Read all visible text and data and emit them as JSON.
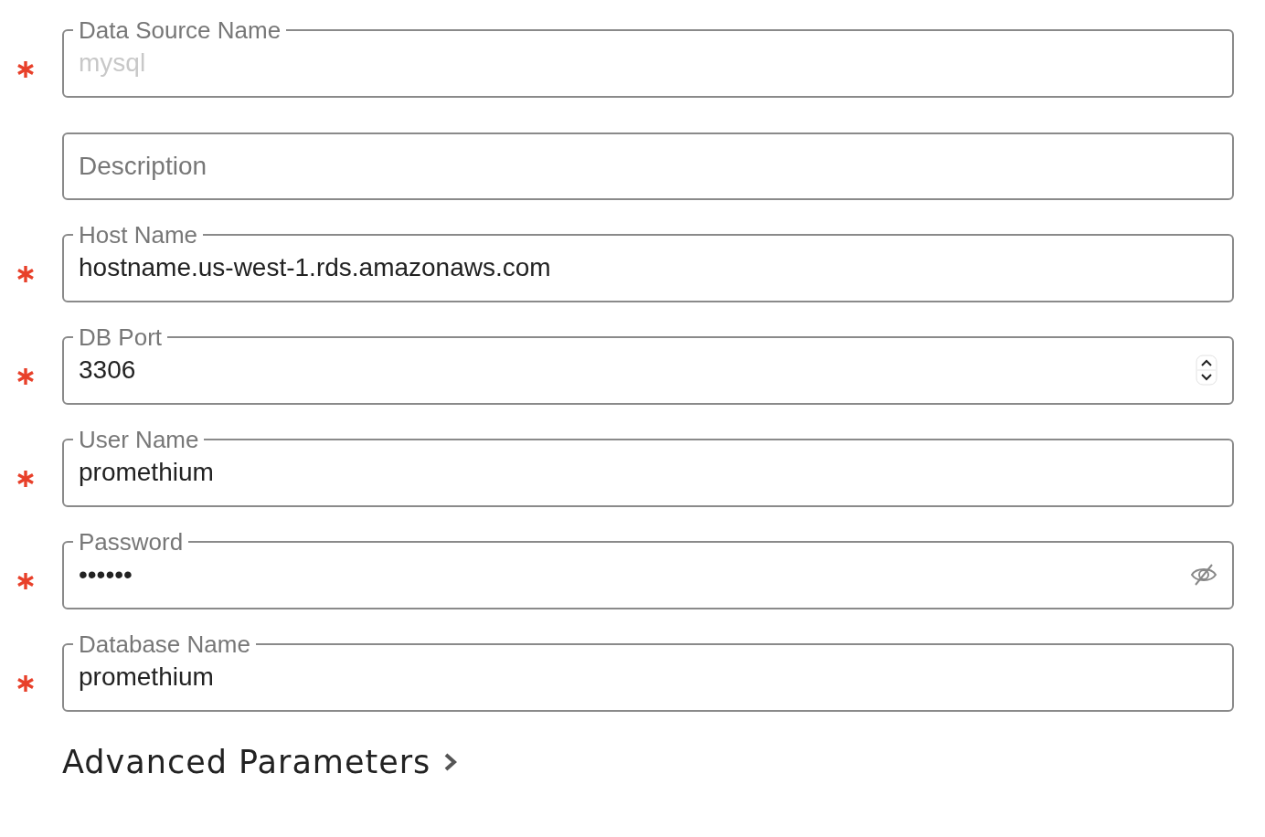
{
  "fields": [
    {
      "kind": "text",
      "label": "Data Source Name",
      "placeholder": "mysql",
      "required": true
    },
    {
      "kind": "text",
      "placeholder": "Description",
      "required": false
    },
    {
      "kind": "text",
      "label": "Host Name",
      "value": "hostname.us-west-1.rds.amazonaws.com",
      "required": true
    },
    {
      "kind": "number",
      "label": "DB Port",
      "value": "3306",
      "required": true
    },
    {
      "kind": "text",
      "label": "User Name",
      "value": "promethium",
      "required": true
    },
    {
      "kind": "password",
      "label": "Password",
      "value": "••••••",
      "required": true
    },
    {
      "kind": "text",
      "label": "Database Name",
      "value": "promethium",
      "required": true
    }
  ],
  "advanced": {
    "label": "Advanced Parameters",
    "expanded": false
  }
}
